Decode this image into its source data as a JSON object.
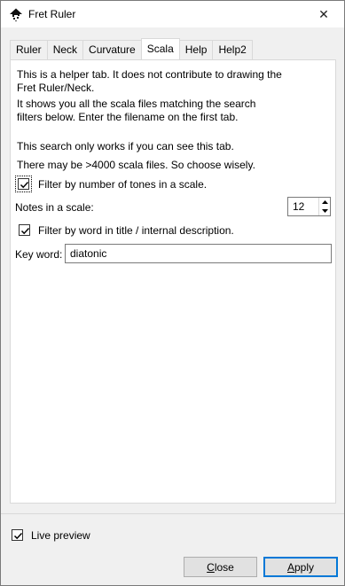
{
  "window": {
    "title": "Fret Ruler",
    "close_glyph": "✕",
    "icon": "inkscape-icon"
  },
  "tabs": [
    {
      "label": "Ruler",
      "active": false
    },
    {
      "label": "Neck",
      "active": false
    },
    {
      "label": "Curvature",
      "active": false
    },
    {
      "label": "Scala",
      "active": true
    },
    {
      "label": "Help",
      "active": false
    },
    {
      "label": "Help2",
      "active": false
    }
  ],
  "scala": {
    "info_1": "This is a helper tab. It does not contribute to drawing the Fret Ruler/Neck.",
    "info_2": "It shows you all the scala files matching the search filters below. Enter the filename on the first tab.",
    "info_3": "This search only works if you can see this tab.",
    "info_4": "There may be >4000 scala files. So choose wisely.",
    "filter_tones_label": "Filter by number of tones in a scale.",
    "filter_tones_checked": true,
    "notes_label": "Notes in a scale:",
    "notes_value": "12",
    "filter_word_label": "Filter by word in title / internal description.",
    "filter_word_checked": true,
    "keyword_label": "Key word:",
    "keyword_value": "diatonic"
  },
  "footer": {
    "live_preview_label": "Live preview",
    "live_preview_checked": true,
    "close_button_first": "C",
    "close_button_rest": "lose",
    "apply_button_first": "A",
    "apply_button_rest": "pply"
  },
  "colors": {
    "accent": "#0078d7",
    "button_bg": "#e1e1e1",
    "dialog_bg": "#f0f0f0"
  }
}
